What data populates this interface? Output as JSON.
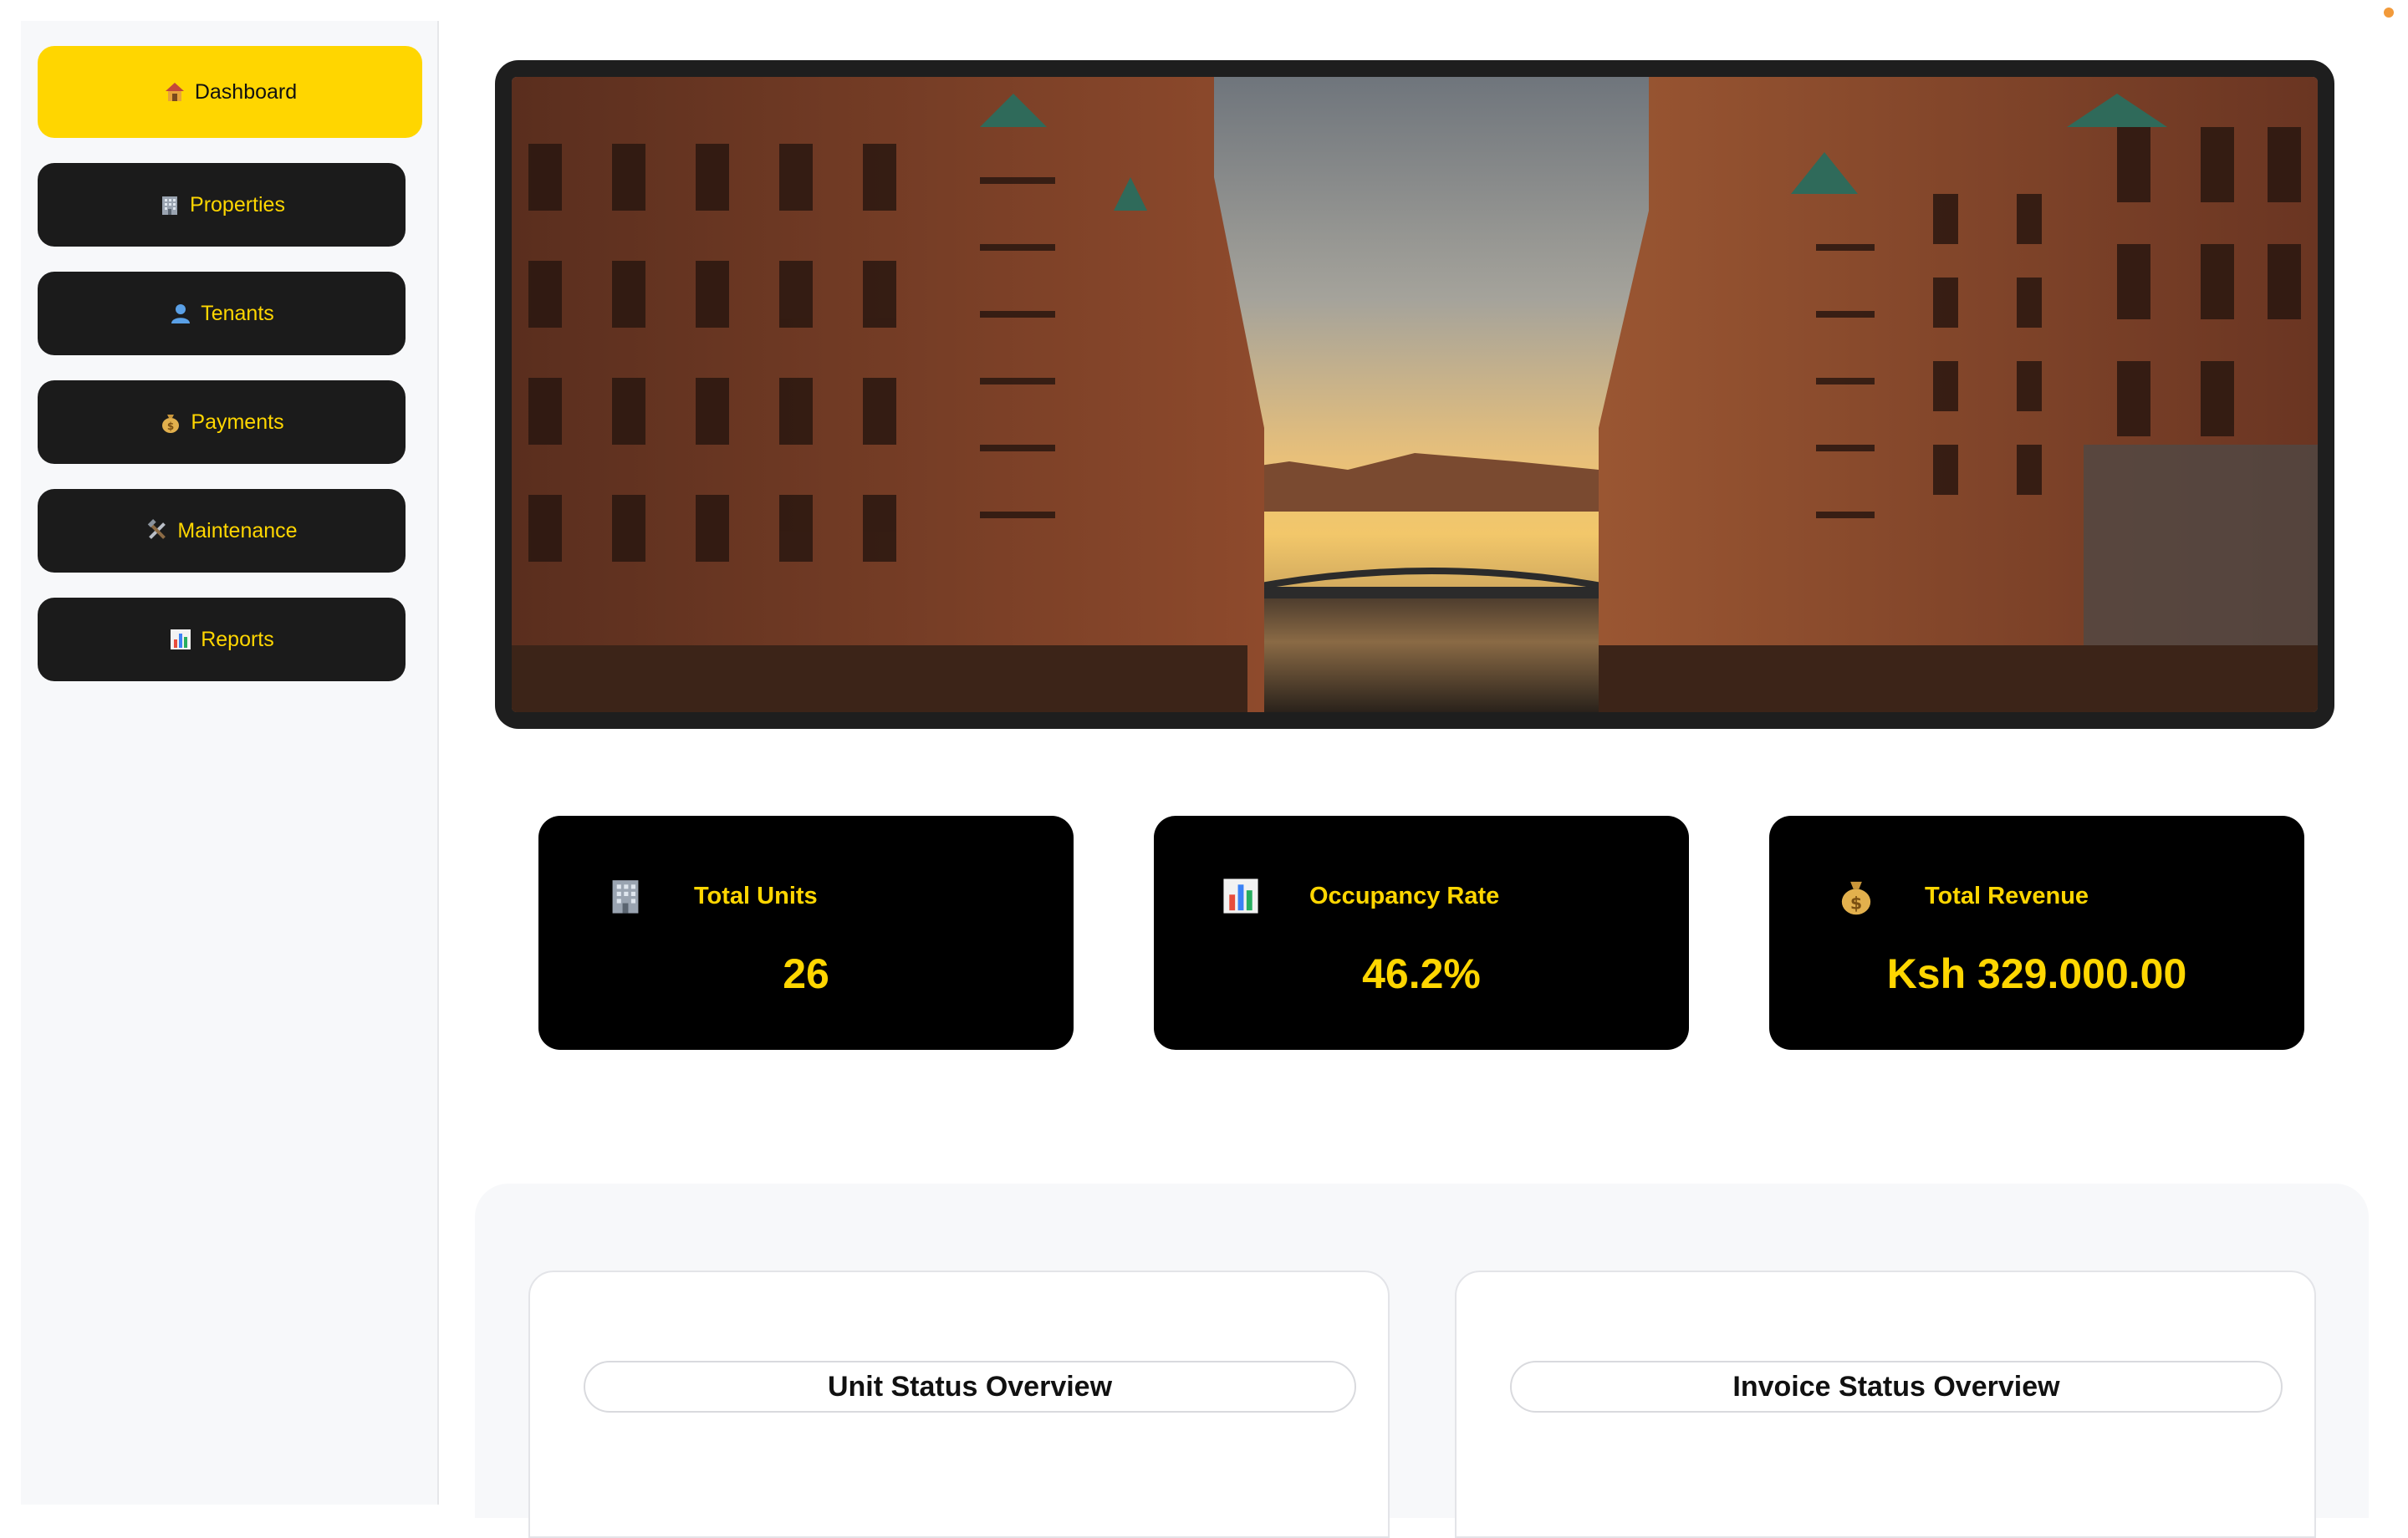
{
  "sidebar": {
    "items": [
      {
        "icon": "house-icon",
        "label": "Dashboard",
        "active": true
      },
      {
        "icon": "office-building-icon",
        "label": "Properties"
      },
      {
        "icon": "person-icon",
        "label": "Tenants"
      },
      {
        "icon": "money-bag-icon",
        "label": "Payments"
      },
      {
        "icon": "hammer-wrench-icon",
        "label": "Maintenance"
      },
      {
        "icon": "bar-chart-icon",
        "label": "Reports"
      }
    ]
  },
  "stats": [
    {
      "icon": "office-building-icon",
      "label": "Total Units",
      "value": "26"
    },
    {
      "icon": "bar-chart-icon",
      "label": "Occupancy Rate",
      "value": "46.2%"
    },
    {
      "icon": "money-bag-icon",
      "label": "Total Revenue",
      "value": "Ksh 329.000.00"
    }
  ],
  "charts": [
    {
      "title": "Unit Status Overview"
    },
    {
      "title": "Invoice Status Overview"
    }
  ],
  "colors": {
    "accent": "#ffd600",
    "sidebar_button": "#1b1b1b",
    "card": "#000000",
    "panel": "#f7f8fa"
  }
}
